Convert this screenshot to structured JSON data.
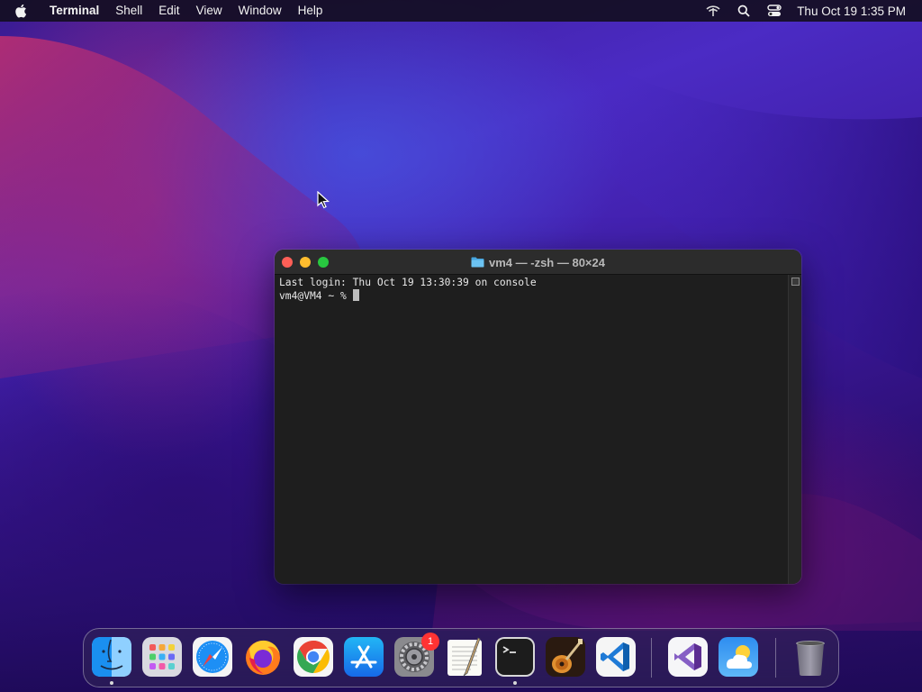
{
  "menubar": {
    "apple_icon": "apple-icon",
    "app_name": "Terminal",
    "menus": [
      "Shell",
      "Edit",
      "View",
      "Window",
      "Help"
    ],
    "status_icons": [
      "wifi-icon",
      "search-icon",
      "control-center-icon"
    ],
    "clock": "Thu Oct 19  1:35 PM"
  },
  "terminal": {
    "title": "vm4 — -zsh — 80×24",
    "folder_icon": "folder-icon",
    "lines": [
      "Last login: Thu Oct 19 13:30:39 on console",
      "vm4@VM4 ~ % "
    ]
  },
  "dock": {
    "items": [
      {
        "name": "Finder",
        "icon": "finder-icon",
        "running": true
      },
      {
        "name": "Launchpad",
        "icon": "launchpad-icon",
        "running": false
      },
      {
        "name": "Safari",
        "icon": "safari-icon",
        "running": false
      },
      {
        "name": "Firefox",
        "icon": "firefox-icon",
        "running": false
      },
      {
        "name": "Google Chrome",
        "icon": "chrome-icon",
        "running": false
      },
      {
        "name": "App Store",
        "icon": "app-store-icon",
        "running": false
      },
      {
        "name": "System Preferences",
        "icon": "system-preferences-icon",
        "running": false,
        "badge": "1"
      },
      {
        "name": "TextEdit",
        "icon": "textedit-icon",
        "running": false
      },
      {
        "name": "Terminal",
        "icon": "terminal-icon",
        "running": true
      },
      {
        "name": "GarageBand",
        "icon": "garageband-icon",
        "running": false
      },
      {
        "name": "Visual Studio Code",
        "icon": "vscode-icon",
        "running": false
      },
      {
        "name": "Visual Studio",
        "icon": "visual-studio-icon",
        "running": false
      },
      {
        "name": "Weather",
        "icon": "weather-icon",
        "running": false
      },
      {
        "name": "Trash",
        "icon": "trash-icon",
        "running": false
      }
    ]
  }
}
